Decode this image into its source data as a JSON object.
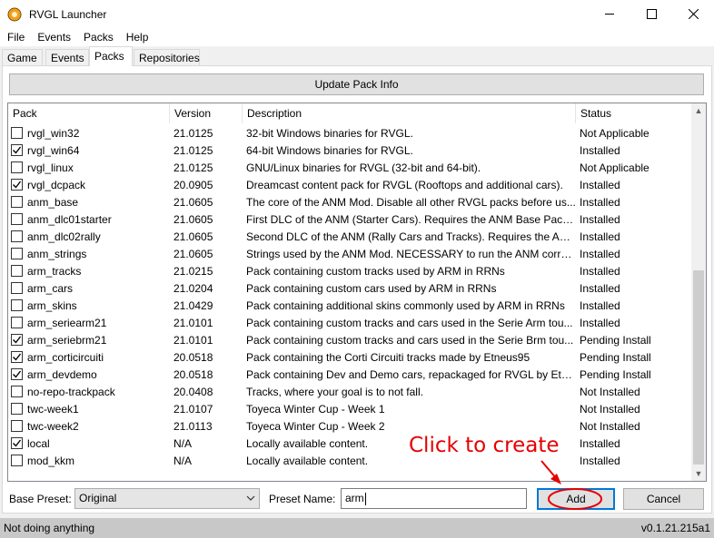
{
  "window": {
    "title": "RVGL Launcher",
    "icon": "rvgl-app-icon"
  },
  "menu": [
    "File",
    "Events",
    "Packs",
    "Help"
  ],
  "tabs": [
    {
      "label": "Game",
      "active": false
    },
    {
      "label": "Events",
      "active": false
    },
    {
      "label": "Packs",
      "active": true
    },
    {
      "label": "Repositories",
      "active": false
    }
  ],
  "update_button": "Update Pack Info",
  "table": {
    "headers": [
      "Pack",
      "Version",
      "Description",
      "Status"
    ],
    "rows": [
      {
        "checked": false,
        "pack": "rvgl_win32",
        "version": "21.0125",
        "description": "32-bit Windows binaries for RVGL.",
        "status": "Not Applicable"
      },
      {
        "checked": true,
        "pack": "rvgl_win64",
        "version": "21.0125",
        "description": "64-bit Windows binaries for RVGL.",
        "status": "Installed"
      },
      {
        "checked": false,
        "pack": "rvgl_linux",
        "version": "21.0125",
        "description": "GNU/Linux binaries for RVGL (32-bit and 64-bit).",
        "status": "Not Applicable"
      },
      {
        "checked": true,
        "pack": "rvgl_dcpack",
        "version": "20.0905",
        "description": "Dreamcast content pack for RVGL (Rooftops and additional cars).",
        "status": "Installed"
      },
      {
        "checked": false,
        "pack": "anm_base",
        "version": "21.0605",
        "description": "The core of the ANM Mod. Disable all other RVGL packs before us...",
        "status": "Installed"
      },
      {
        "checked": false,
        "pack": "anm_dlc01starter",
        "version": "21.0605",
        "description": "First DLC of the ANM (Starter Cars). Requires the ANM Base Pack ...",
        "status": "Installed"
      },
      {
        "checked": false,
        "pack": "anm_dlc02rally",
        "version": "21.0605",
        "description": "Second DLC of the ANM (Rally Cars and Tracks). Requires the ANM...",
        "status": "Installed"
      },
      {
        "checked": false,
        "pack": "anm_strings",
        "version": "21.0605",
        "description": "Strings used by the ANM Mod. NECESSARY to run the ANM corre...",
        "status": "Installed"
      },
      {
        "checked": false,
        "pack": "arm_tracks",
        "version": "21.0215",
        "description": "Pack containing custom tracks used by ARM in RRNs",
        "status": "Installed"
      },
      {
        "checked": false,
        "pack": "arm_cars",
        "version": "21.0204",
        "description": "Pack containing custom cars used by ARM in RRNs",
        "status": "Installed"
      },
      {
        "checked": false,
        "pack": "arm_skins",
        "version": "21.0429",
        "description": "Pack containing additional skins commonly used by ARM in RRNs",
        "status": "Installed"
      },
      {
        "checked": false,
        "pack": "arm_seriearm21",
        "version": "21.0101",
        "description": "Pack containing custom tracks and cars used in the Serie Arm tou...",
        "status": "Installed"
      },
      {
        "checked": true,
        "pack": "arm_seriebrm21",
        "version": "21.0101",
        "description": "Pack containing custom tracks and cars used in the Serie Brm tou...",
        "status": "Pending Install"
      },
      {
        "checked": true,
        "pack": "arm_corticircuiti",
        "version": "20.0518",
        "description": "Pack containing the Corti Circuiti tracks made by Etneus95",
        "status": "Pending Install"
      },
      {
        "checked": true,
        "pack": "arm_devdemo",
        "version": "20.0518",
        "description": "Pack containing Dev and Demo cars, repackaged for RVGL by Etn...",
        "status": "Pending Install"
      },
      {
        "checked": false,
        "pack": "no-repo-trackpack",
        "version": "20.0408",
        "description": "Tracks, where your goal is to not fall.",
        "status": "Not Installed"
      },
      {
        "checked": false,
        "pack": "twc-week1",
        "version": "21.0107",
        "description": "Toyeca Winter Cup - Week 1",
        "status": "Not Installed"
      },
      {
        "checked": false,
        "pack": "twc-week2",
        "version": "21.0113",
        "description": "Toyeca Winter Cup - Week 2",
        "status": "Not Installed"
      },
      {
        "checked": true,
        "pack": "local",
        "version": "N/A",
        "description": "Locally available content.",
        "status": "Installed"
      },
      {
        "checked": false,
        "pack": "mod_kkm",
        "version": "N/A",
        "description": "Locally available content.",
        "status": "Installed"
      }
    ]
  },
  "bottom": {
    "base_preset_label": "Base Preset:",
    "base_preset_value": "Original",
    "preset_name_label": "Preset Name:",
    "preset_name_value": "arm",
    "add_button": "Add",
    "cancel_button": "Cancel"
  },
  "status": {
    "left": "Not doing anything",
    "right": "v0.1.21.215a1"
  },
  "annotation": {
    "text": "Click to create",
    "color": "#e60000"
  }
}
